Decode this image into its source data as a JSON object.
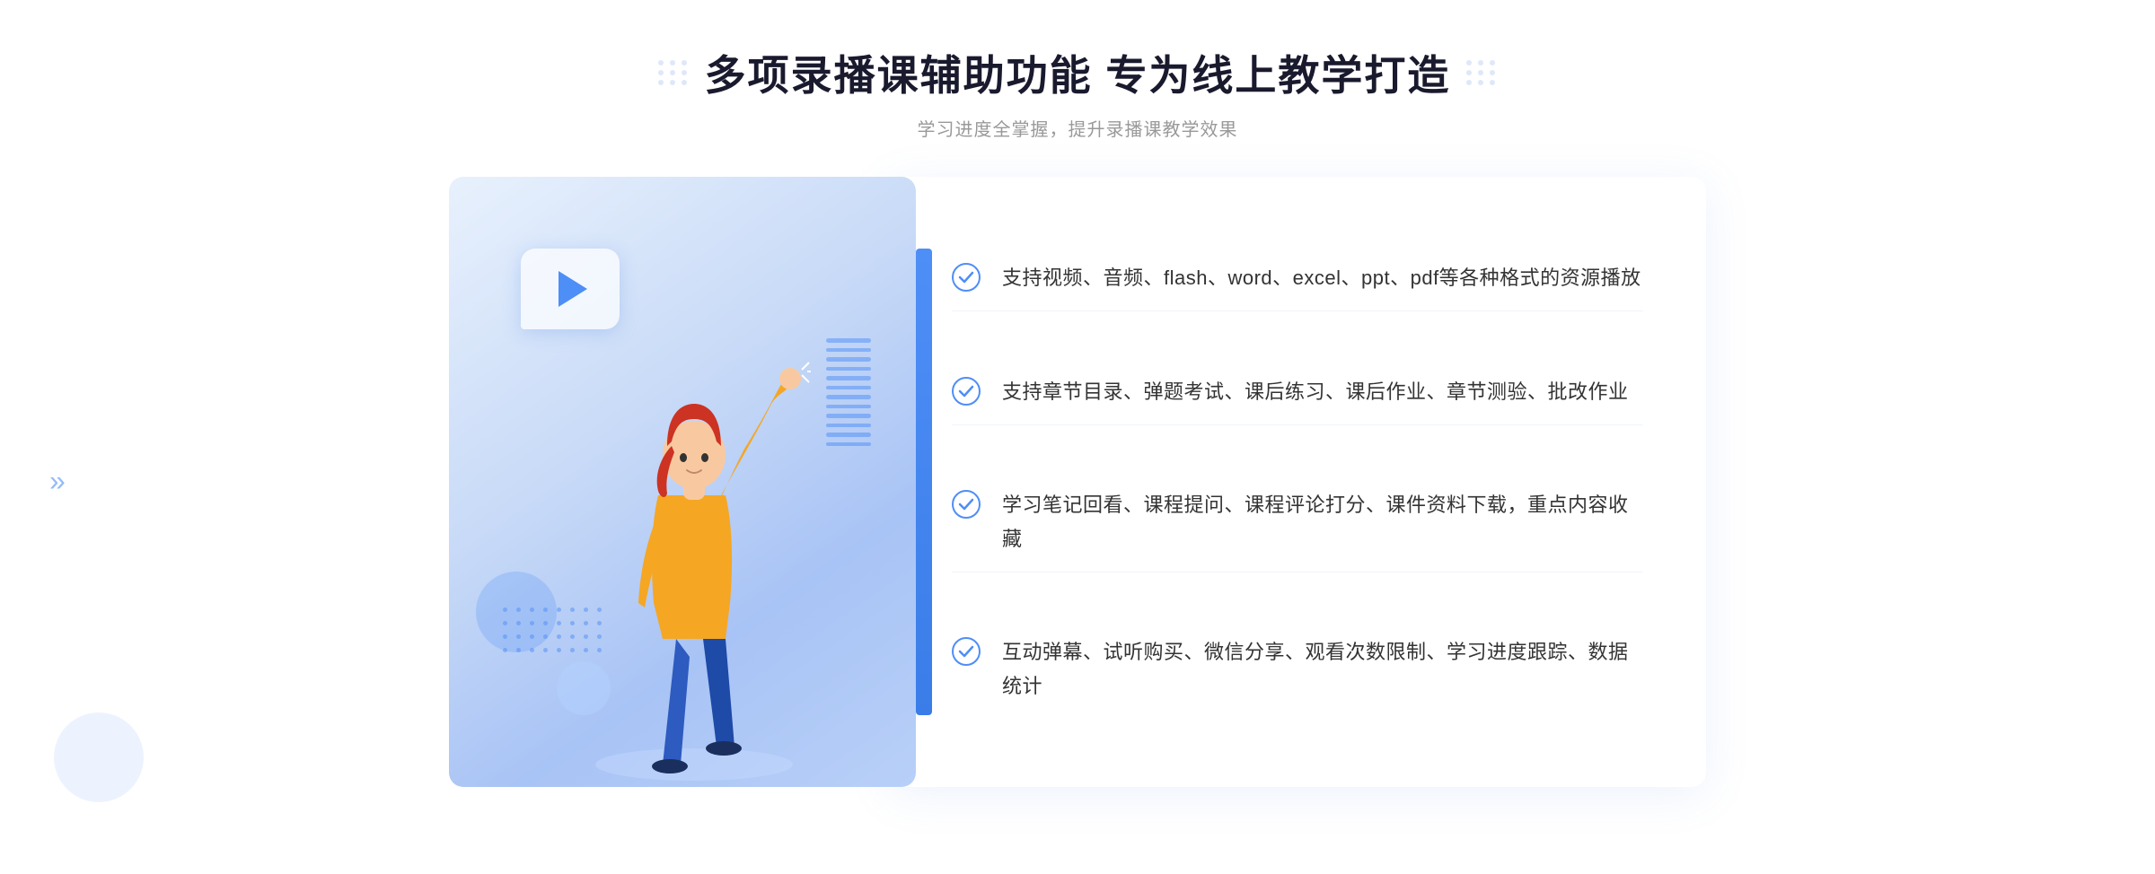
{
  "header": {
    "title": "多项录播课辅助功能 专为线上教学打造",
    "subtitle": "学习进度全掌握，提升录播课教学效果"
  },
  "features": [
    {
      "id": "feature-1",
      "text": "支持视频、音频、flash、word、excel、ppt、pdf等各种格式的资源播放"
    },
    {
      "id": "feature-2",
      "text": "支持章节目录、弹题考试、课后练习、课后作业、章节测验、批改作业"
    },
    {
      "id": "feature-3",
      "text": "学习笔记回看、课程提问、课程评论打分、课件资料下载，重点内容收藏"
    },
    {
      "id": "feature-4",
      "text": "互动弹幕、试听购买、微信分享、观看次数限制、学习进度跟踪、数据统计"
    }
  ],
  "decorations": {
    "left_arrow": "»",
    "check_color": "#4e8ef7",
    "accent_color": "#4e8ef7"
  }
}
